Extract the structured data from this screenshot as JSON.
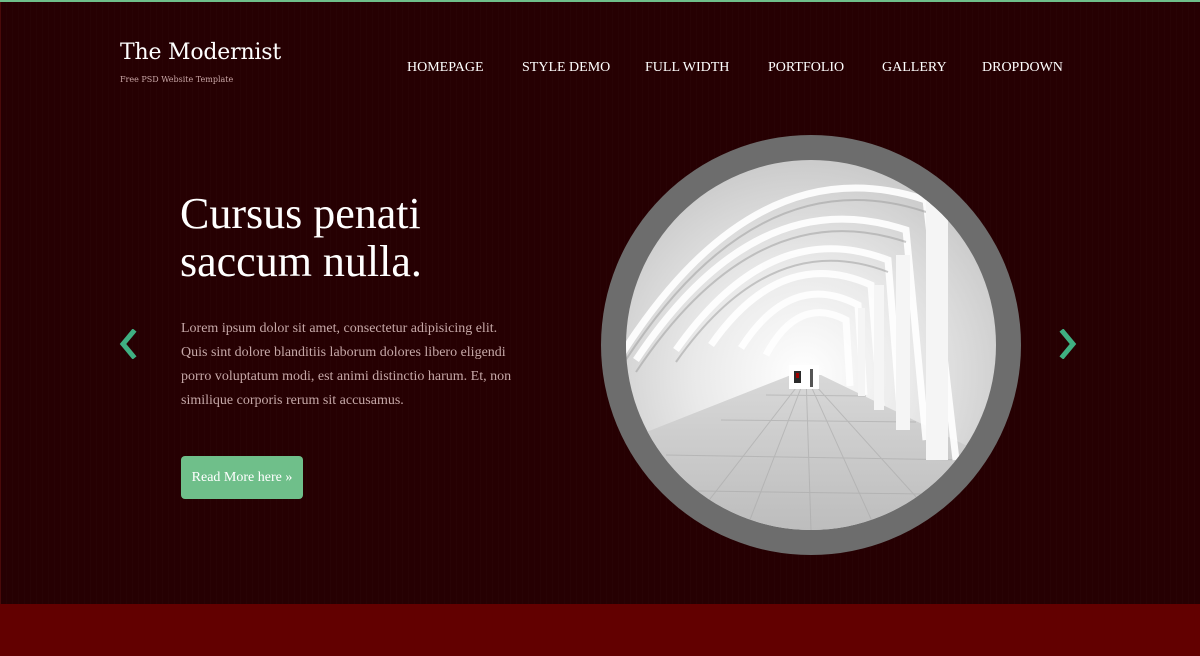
{
  "brand": {
    "title": "The Modernist",
    "subtitle": "Free PSD Website Template"
  },
  "nav": {
    "items": [
      {
        "label": "HOMEPAGE"
      },
      {
        "label": "STYLE DEMO"
      },
      {
        "label": "FULL WIDTH"
      },
      {
        "label": "PORTFOLIO"
      },
      {
        "label": "GALLERY"
      },
      {
        "label": "DROPDOWN"
      }
    ]
  },
  "hero": {
    "headline": "Cursus penati saccum nulla.",
    "body": "Lorem ipsum dolor sit amet, consectetur adipisicing elit. Quis sint dolore blanditiis laborum dolores libero eligendi porro voluptatum modi, est animi distinctio harum. Et, non similique corporis rerum sit accusamus.",
    "button_label": "Read More here »",
    "image_icon": "architecture-corridor-photo",
    "prev_icon": "chevron-left-icon",
    "next_icon": "chevron-right-icon"
  },
  "colors": {
    "background": "#260002",
    "accent": "#6fbf8a",
    "footer": "#620000",
    "ring": "#6d6d6d"
  }
}
